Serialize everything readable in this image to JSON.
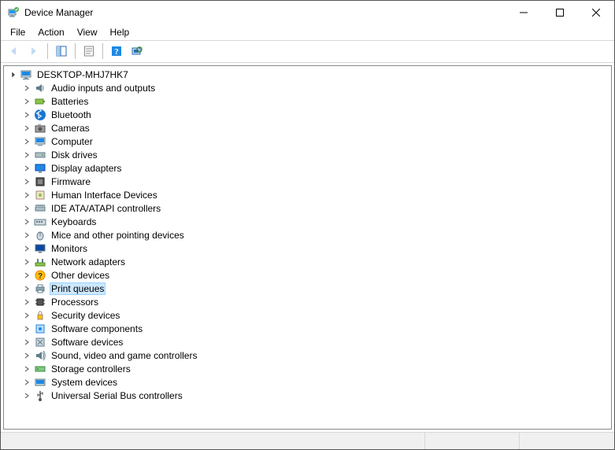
{
  "title": "Device Manager",
  "menus": {
    "file": "File",
    "action": "Action",
    "view": "View",
    "help": "Help"
  },
  "tree": {
    "root": "DESKTOP-MHJ7HK7",
    "items": [
      {
        "label": "Audio inputs and outputs",
        "icon": "audio"
      },
      {
        "label": "Batteries",
        "icon": "battery"
      },
      {
        "label": "Bluetooth",
        "icon": "bluetooth"
      },
      {
        "label": "Cameras",
        "icon": "camera"
      },
      {
        "label": "Computer",
        "icon": "computer"
      },
      {
        "label": "Disk drives",
        "icon": "disk"
      },
      {
        "label": "Display adapters",
        "icon": "display"
      },
      {
        "label": "Firmware",
        "icon": "firmware"
      },
      {
        "label": "Human Interface Devices",
        "icon": "hid"
      },
      {
        "label": "IDE ATA/ATAPI controllers",
        "icon": "ide"
      },
      {
        "label": "Keyboards",
        "icon": "keyboard"
      },
      {
        "label": "Mice and other pointing devices",
        "icon": "mouse"
      },
      {
        "label": "Monitors",
        "icon": "monitor"
      },
      {
        "label": "Network adapters",
        "icon": "network"
      },
      {
        "label": "Other devices",
        "icon": "other"
      },
      {
        "label": "Print queues",
        "icon": "printer",
        "selected": true
      },
      {
        "label": "Processors",
        "icon": "cpu"
      },
      {
        "label": "Security devices",
        "icon": "security"
      },
      {
        "label": "Software components",
        "icon": "swcomp"
      },
      {
        "label": "Software devices",
        "icon": "swdev"
      },
      {
        "label": "Sound, video and game controllers",
        "icon": "sound"
      },
      {
        "label": "Storage controllers",
        "icon": "storage"
      },
      {
        "label": "System devices",
        "icon": "system"
      },
      {
        "label": "Universal Serial Bus controllers",
        "icon": "usb"
      }
    ]
  }
}
